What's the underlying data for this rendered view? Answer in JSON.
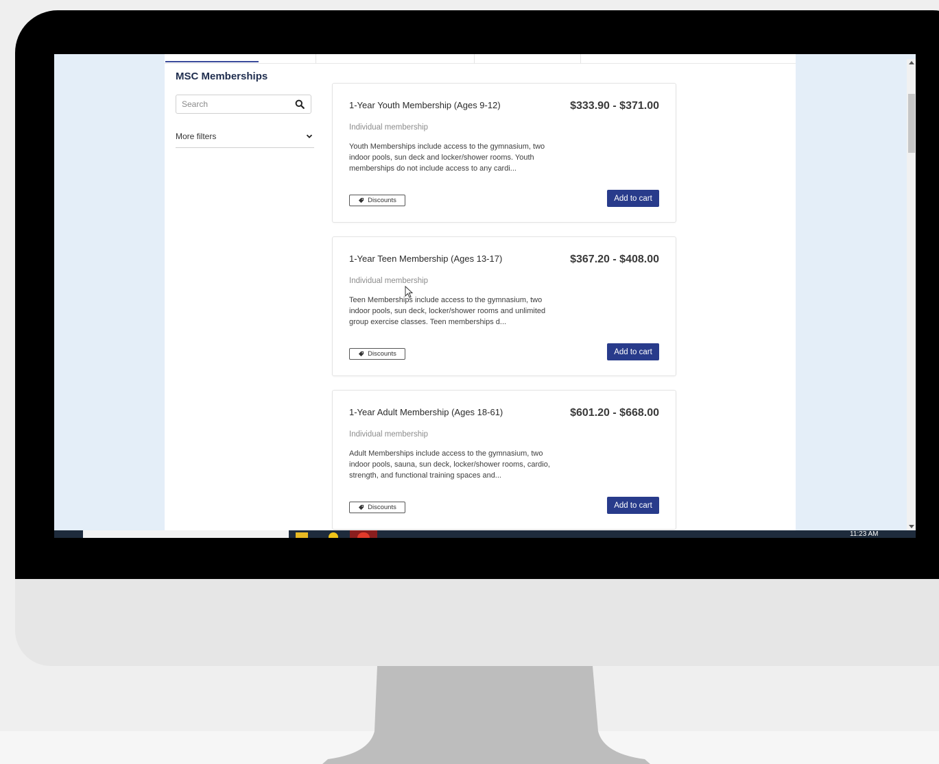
{
  "sidebar": {
    "title": "MSC Memberships",
    "search_placeholder": "Search",
    "filters_label": "More filters"
  },
  "memberships": [
    {
      "title": "1-Year Youth Membership (Ages 9-12)",
      "price": "$333.90 - $371.00",
      "type": "Individual membership",
      "description": "Youth Memberships include access to the gymnasium, two indoor pools, sun deck and locker/shower rooms. Youth memberships do not include access to any cardi...",
      "discount_label": "Discounts",
      "cart_label": "Add to cart"
    },
    {
      "title": "1-Year Teen Membership (Ages 13-17)",
      "price": "$367.20 - $408.00",
      "type": "Individual membership",
      "description": "Teen Memberships include access to the gymnasium, two indoor pools, sun deck, locker/shower rooms and unlimited group exercise classes. Teen memberships d...",
      "discount_label": "Discounts",
      "cart_label": "Add to cart"
    },
    {
      "title": "1-Year Adult Membership (Ages 18-61)",
      "price": "$601.20 - $668.00",
      "type": "Individual membership",
      "description": "Adult Memberships include access to the gymnasium, two indoor pools, sauna, sun deck, locker/shower rooms, cardio, strength, and functional training spaces and...",
      "discount_label": "Discounts",
      "cart_label": "Add to cart"
    }
  ],
  "taskbar": {
    "clock": "11:23 AM"
  },
  "colors": {
    "accent": "#283b8b",
    "title": "#1f2d4e",
    "page_bg": "#e4eef8"
  }
}
